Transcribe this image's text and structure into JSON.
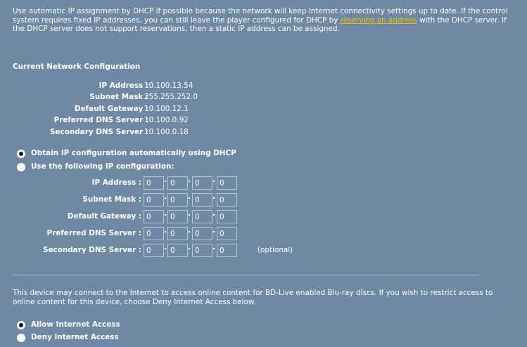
{
  "intro": {
    "text_before_link": "Use automatic IP assignment by DHCP if possible because the network will keep Internet connectivity settings up to date. If the control system requires fixed IP addresses, you can still leave the player configured for DHCP by ",
    "link": "reserving an address",
    "text_after_link": " with the DHCP server. If the DHCP server does not support reservations, then a static IP address can be assigned."
  },
  "current": {
    "heading": "Current Network Configuration",
    "rows": [
      {
        "label": "IP Address :",
        "value": "10.100.13.54"
      },
      {
        "label": "Subnet Mask :",
        "value": "255.255.252.0"
      },
      {
        "label": "Default Gateway :",
        "value": "10.100.12.1"
      },
      {
        "label": "Preferred DNS Server :",
        "value": "10.100.0.92"
      },
      {
        "label": "Secondary DNS Server :",
        "value": "10.100.0.18"
      }
    ]
  },
  "ip_mode": {
    "options": [
      {
        "label": "Obtain IP configuration automatically using DHCP",
        "checked": true
      },
      {
        "label": "Use the following IP configuration:",
        "checked": false
      }
    ]
  },
  "static": {
    "rows": [
      {
        "label": "IP Address :",
        "octets": [
          "0",
          "0",
          "0",
          "0"
        ]
      },
      {
        "label": "Subnet Mask :",
        "octets": [
          "0",
          "0",
          "0",
          "0"
        ]
      },
      {
        "label": "Default Gateway :",
        "octets": [
          "0",
          "0",
          "0",
          "0"
        ]
      },
      {
        "label": "Preferred DNS Server :",
        "octets": [
          "0",
          "0",
          "0",
          "0"
        ]
      },
      {
        "label": "Secondary DNS Server :",
        "octets": [
          "0",
          "0",
          "0",
          "0"
        ]
      }
    ],
    "optional_note": "(optional)"
  },
  "internet": {
    "text": "This device may connect to the Internet to access online content for BD-Live enabled Blu-ray discs. If you wish to restrict access to online content for this device, choose Deny Internet Access below.",
    "options": [
      {
        "label": "Allow Internet Access",
        "checked": true
      },
      {
        "label": "Deny Internet Access",
        "checked": false
      }
    ]
  }
}
